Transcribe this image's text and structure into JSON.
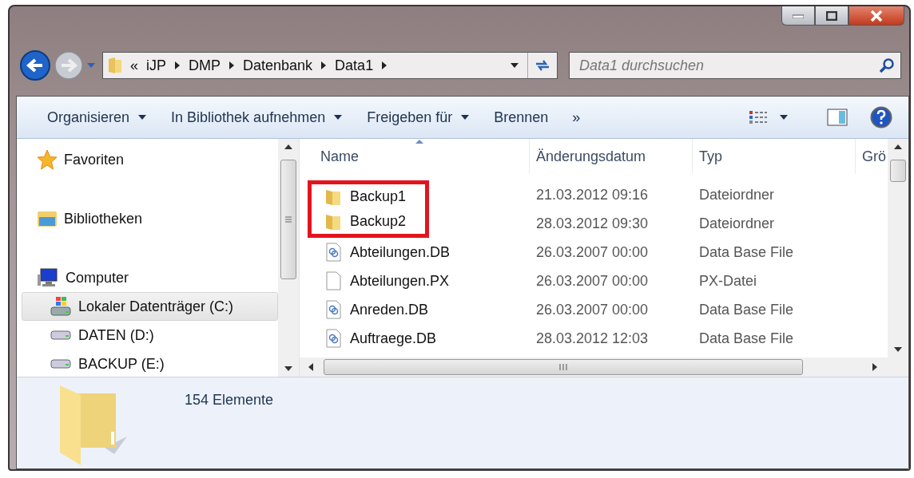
{
  "address": {
    "overflow": "«",
    "crumbs": [
      "iJP",
      "DMP",
      "Datenbank",
      "Data1"
    ]
  },
  "search": {
    "placeholder": "Data1 durchsuchen"
  },
  "toolbar": [
    {
      "label": "Organisieren",
      "dropdown": true
    },
    {
      "label": "In Bibliothek aufnehmen",
      "dropdown": true
    },
    {
      "label": "Freigeben für",
      "dropdown": true
    },
    {
      "label": "Brennen",
      "dropdown": false
    }
  ],
  "toolbar_more": "»",
  "sidebar": {
    "items": [
      {
        "label": "Favoriten",
        "kind": "favorites",
        "selected": false
      },
      {
        "label": "Bibliotheken",
        "kind": "libraries",
        "selected": false
      },
      {
        "label": "Computer",
        "kind": "computer",
        "selected": false,
        "children": [
          {
            "label": "Lokaler Datenträger (C:)",
            "kind": "system-drive",
            "selected": true
          },
          {
            "label": "DATEN (D:)",
            "kind": "drive",
            "selected": false
          },
          {
            "label": "BACKUP (E:)",
            "kind": "drive",
            "selected": false
          }
        ]
      }
    ]
  },
  "table": {
    "columns": [
      "Name",
      "Änderungsdatum",
      "Typ",
      "Grö"
    ],
    "rows": [
      {
        "name": "Backup1",
        "date": "21.03.2012 09:16",
        "type": "Dateiordner",
        "kind": "folder",
        "highlighted": true
      },
      {
        "name": "Backup2",
        "date": "28.03.2012 09:30",
        "type": "Dateiordner",
        "kind": "folder",
        "highlighted": true
      },
      {
        "name": "Abteilungen.DB",
        "date": "26.03.2007 00:00",
        "type": "Data Base File",
        "kind": "db",
        "highlighted": false
      },
      {
        "name": "Abteilungen.PX",
        "date": "26.03.2007 00:00",
        "type": "PX-Datei",
        "kind": "file",
        "highlighted": false
      },
      {
        "name": "Anreden.DB",
        "date": "26.03.2007 00:00",
        "type": "Data Base File",
        "kind": "db",
        "highlighted": false
      },
      {
        "name": "Auftraege.DB",
        "date": "28.03.2012 12:03",
        "type": "Data Base File",
        "kind": "db",
        "highlighted": false
      }
    ]
  },
  "details": {
    "count": "154 Elemente"
  }
}
